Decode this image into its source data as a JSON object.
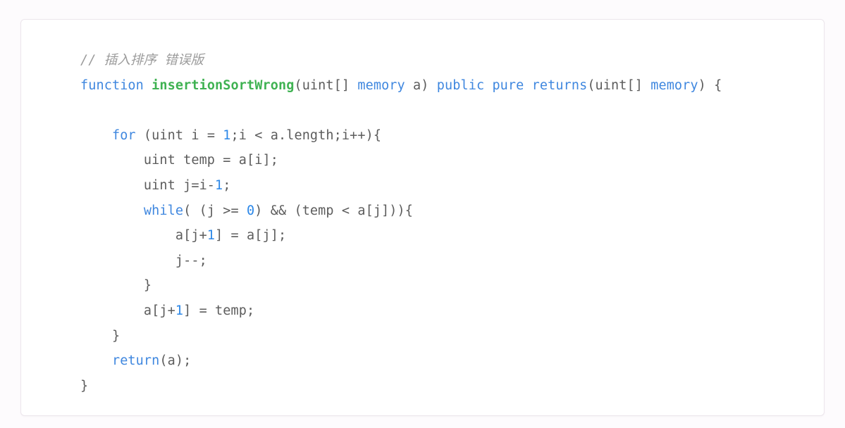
{
  "card": {
    "background_color": "#ffffff",
    "border_color": "#ece6ec",
    "page_background_color": "#fdfbfd"
  },
  "code": {
    "language": "solidity",
    "colors": {
      "comment": "#9b9b9b",
      "keyword": "#3f87df",
      "function_name": "#3fb252",
      "number": "#2b87e8",
      "plain": "#5c5c5c"
    },
    "lines": [
      {
        "index": 0,
        "text": "// 插入排序 错误版",
        "tokens": [
          {
            "t": "// 插入排序 错误版",
            "c": "comment"
          }
        ]
      },
      {
        "index": 1,
        "text": "function insertionSortWrong(uint[] memory a) public pure returns(uint[] memory) {",
        "tokens": [
          {
            "t": "function",
            "c": "keyword"
          },
          {
            "t": " ",
            "c": "plain"
          },
          {
            "t": "insertionSortWrong",
            "c": "function"
          },
          {
            "t": "(uint[] ",
            "c": "plain"
          },
          {
            "t": "memory",
            "c": "keyword"
          },
          {
            "t": " a) ",
            "c": "plain"
          },
          {
            "t": "public",
            "c": "keyword"
          },
          {
            "t": " ",
            "c": "plain"
          },
          {
            "t": "pure",
            "c": "keyword"
          },
          {
            "t": " ",
            "c": "plain"
          },
          {
            "t": "returns",
            "c": "keyword"
          },
          {
            "t": "(uint[] ",
            "c": "plain"
          },
          {
            "t": "memory",
            "c": "keyword"
          },
          {
            "t": ") {",
            "c": "plain"
          }
        ]
      },
      {
        "index": 2,
        "text": "",
        "tokens": []
      },
      {
        "index": 3,
        "text": "    for (uint i = 1;i < a.length;i++){",
        "tokens": [
          {
            "t": "    ",
            "c": "plain"
          },
          {
            "t": "for",
            "c": "keyword"
          },
          {
            "t": " (uint i = ",
            "c": "plain"
          },
          {
            "t": "1",
            "c": "number"
          },
          {
            "t": ";i < a.length;i++){",
            "c": "plain"
          }
        ]
      },
      {
        "index": 4,
        "text": "        uint temp = a[i];",
        "tokens": [
          {
            "t": "        uint temp = a[i];",
            "c": "plain"
          }
        ]
      },
      {
        "index": 5,
        "text": "        uint j=i-1;",
        "tokens": [
          {
            "t": "        uint j=i-",
            "c": "plain"
          },
          {
            "t": "1",
            "c": "number"
          },
          {
            "t": ";",
            "c": "plain"
          }
        ]
      },
      {
        "index": 6,
        "text": "        while( (j >= 0) && (temp < a[j])){",
        "tokens": [
          {
            "t": "        ",
            "c": "plain"
          },
          {
            "t": "while",
            "c": "keyword"
          },
          {
            "t": "( (j >= ",
            "c": "plain"
          },
          {
            "t": "0",
            "c": "number"
          },
          {
            "t": ") && (temp < a[j])){",
            "c": "plain"
          }
        ]
      },
      {
        "index": 7,
        "text": "            a[j+1] = a[j];",
        "tokens": [
          {
            "t": "            a[j+",
            "c": "plain"
          },
          {
            "t": "1",
            "c": "number"
          },
          {
            "t": "] = a[j];",
            "c": "plain"
          }
        ]
      },
      {
        "index": 8,
        "text": "            j--;",
        "tokens": [
          {
            "t": "            j--;",
            "c": "plain"
          }
        ]
      },
      {
        "index": 9,
        "text": "        }",
        "tokens": [
          {
            "t": "        }",
            "c": "plain"
          }
        ]
      },
      {
        "index": 10,
        "text": "        a[j+1] = temp;",
        "tokens": [
          {
            "t": "        a[j+",
            "c": "plain"
          },
          {
            "t": "1",
            "c": "number"
          },
          {
            "t": "] = temp;",
            "c": "plain"
          }
        ]
      },
      {
        "index": 11,
        "text": "    }",
        "tokens": [
          {
            "t": "    }",
            "c": "plain"
          }
        ]
      },
      {
        "index": 12,
        "text": "    return(a);",
        "tokens": [
          {
            "t": "    ",
            "c": "plain"
          },
          {
            "t": "return",
            "c": "keyword"
          },
          {
            "t": "(a);",
            "c": "plain"
          }
        ]
      },
      {
        "index": 13,
        "text": "}",
        "tokens": [
          {
            "t": "}",
            "c": "plain"
          }
        ]
      }
    ]
  }
}
